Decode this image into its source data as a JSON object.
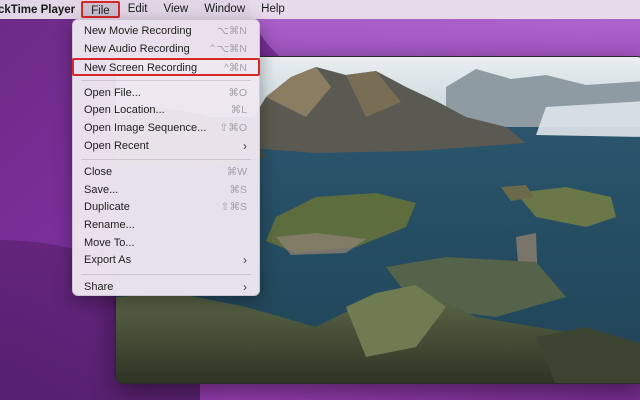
{
  "menubar": {
    "app_name": "ckTime Player",
    "menus": [
      "File",
      "Edit",
      "View",
      "Window",
      "Help"
    ]
  },
  "file_menu": {
    "group1": [
      {
        "label": "New Movie Recording",
        "shortcut": "⌥⌘N"
      },
      {
        "label": "New Audio Recording",
        "shortcut": "⌃⌥⌘N"
      },
      {
        "label": "New Screen Recording",
        "shortcut": "^⌘N"
      }
    ],
    "group2": [
      {
        "label": "Open File...",
        "shortcut": "⌘O"
      },
      {
        "label": "Open Location...",
        "shortcut": "⌘L"
      },
      {
        "label": "Open Image Sequence...",
        "shortcut": "⇧⌘O"
      },
      {
        "label": "Open Recent",
        "shortcut": "›"
      }
    ],
    "group3": [
      {
        "label": "Close",
        "shortcut": "⌘W"
      },
      {
        "label": "Save...",
        "shortcut": "⌘S"
      },
      {
        "label": "Duplicate",
        "shortcut": "⇧⌘S"
      },
      {
        "label": "Rename...",
        "shortcut": ""
      },
      {
        "label": "Move To...",
        "shortcut": ""
      },
      {
        "label": "Export As",
        "shortcut": "›"
      }
    ],
    "group4": [
      {
        "label": "Share",
        "shortcut": "›"
      }
    ]
  },
  "colors": {
    "highlight_border": "#d62828",
    "wallpaper": "#7b2f9a"
  }
}
